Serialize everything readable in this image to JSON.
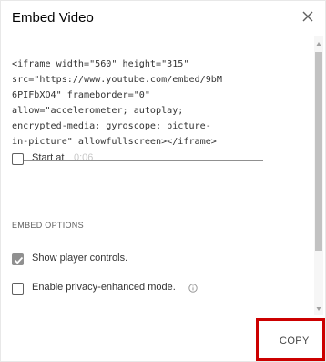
{
  "dialog": {
    "title": "Embed Video",
    "close_icon": "close-icon"
  },
  "embed_code": {
    "lines": [
      "<iframe width=\"560\" height=\"315\"",
      "src=\"https://www.youtube.com/embed/9bM",
      "6PIFbXO4\" frameborder=\"0\"",
      "allow=\"accelerometer; autoplay;",
      "encrypted-media; gyroscope; picture-",
      "in-picture\" allowfullscreen></iframe>"
    ]
  },
  "start_at": {
    "label": "Start at",
    "time": "0:06",
    "checked": false
  },
  "embed_options": {
    "title": "EMBED OPTIONS",
    "show_player_controls": {
      "label": "Show player controls.",
      "checked": true
    },
    "privacy_mode": {
      "label": "Enable privacy-enhanced mode.",
      "checked": false,
      "icon": "info-icon"
    }
  },
  "footer": {
    "copy_label": "COPY",
    "highlight_color": "#cc0000"
  }
}
